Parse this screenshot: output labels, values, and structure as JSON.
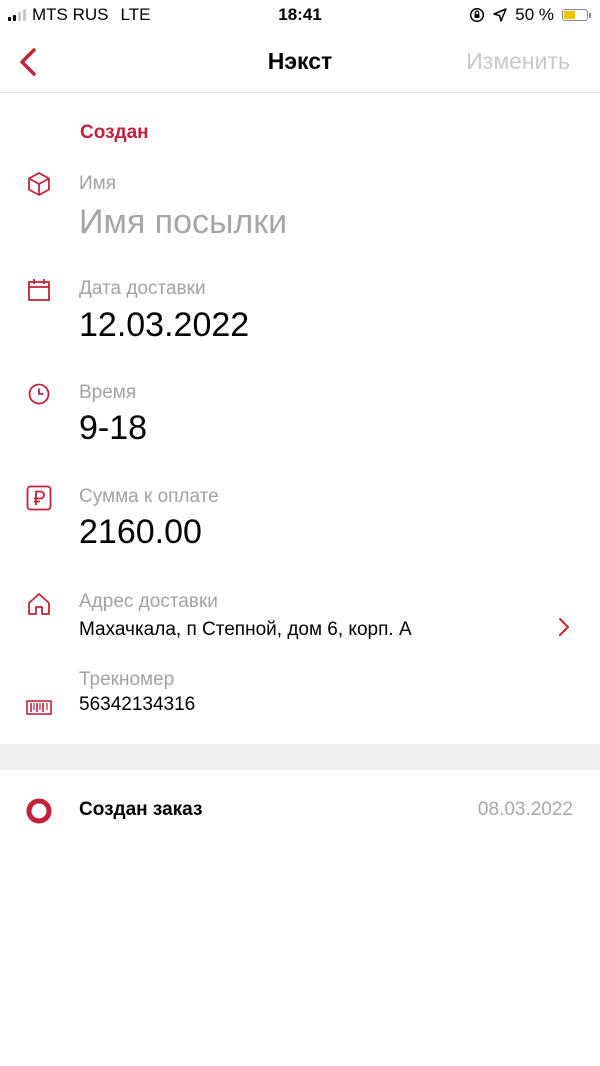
{
  "status_bar": {
    "carrier": "MTS RUS",
    "network": "LTE",
    "time": "18:41",
    "battery": "50 %",
    "battery_level": 0.5,
    "icons": [
      "signal-icon",
      "orientation-lock-icon",
      "location-icon",
      "battery-icon"
    ]
  },
  "nav": {
    "back_icon": "chevron-left-icon",
    "title": "Нэкст",
    "edit_label": "Изменить"
  },
  "order": {
    "status": "Создан",
    "name": {
      "icon": "package-icon",
      "label": "Имя",
      "placeholder": "Имя посылки"
    },
    "delivery_date": {
      "icon": "calendar-icon",
      "label": "Дата доставки",
      "value": "12.03.2022"
    },
    "time": {
      "icon": "clock-icon",
      "label": "Время",
      "value": "9-18"
    },
    "amount": {
      "icon": "ruble-icon",
      "label": "Сумма к оплате",
      "value": "2160.00"
    },
    "address": {
      "icon": "home-icon",
      "label": "Адрес доставки",
      "value": "Махачкала, п Степной, дом 6, корп. А"
    },
    "tracking": {
      "icon": "barcode-icon",
      "label": "Трекномер",
      "value": "56342134316"
    }
  },
  "history": [
    {
      "title": "Создан заказ",
      "date": "08.03.2022"
    }
  ],
  "colors": {
    "accent": "#c4213c",
    "muted_text": "#a2a2a2",
    "separator": "#f0f0f2",
    "battery": "#f2c200"
  }
}
